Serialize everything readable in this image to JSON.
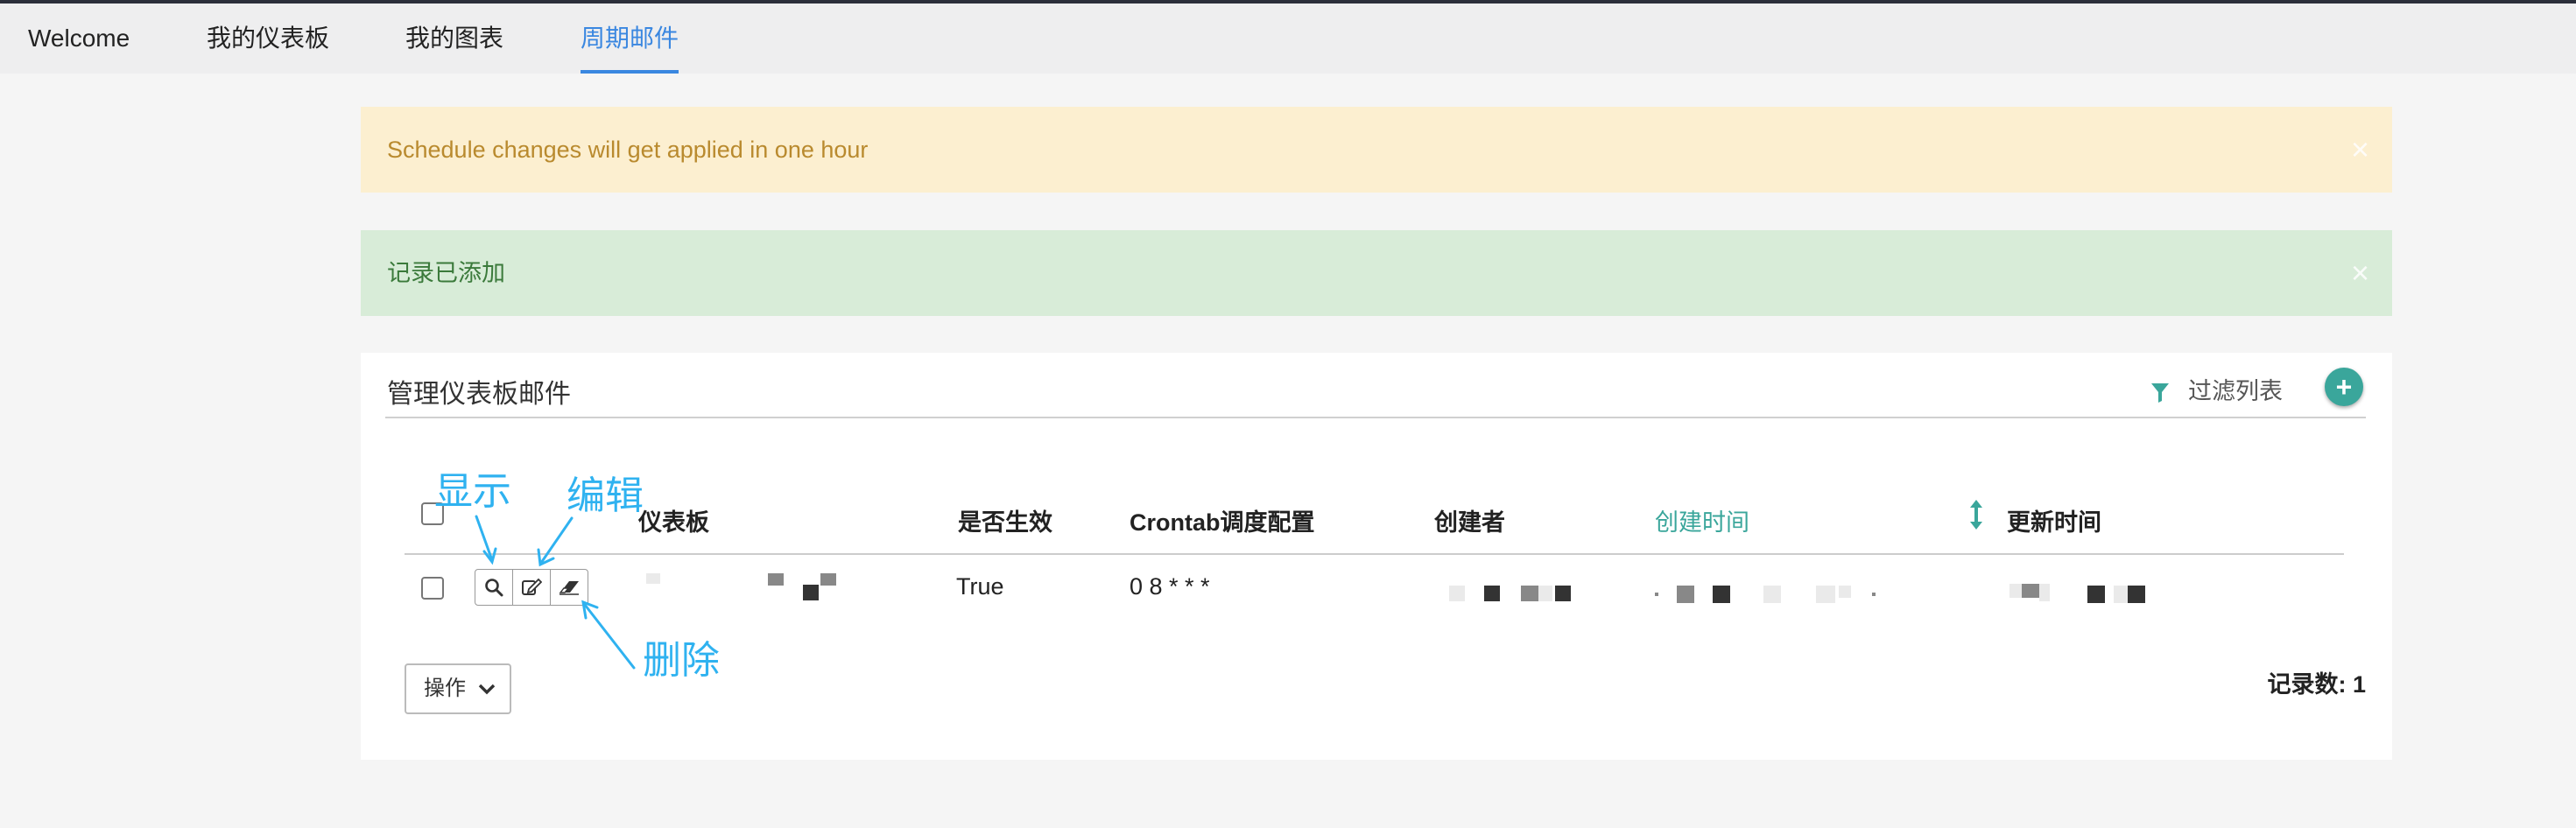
{
  "tabs": [
    {
      "label": "Welcome",
      "active": false
    },
    {
      "label": "我的仪表板",
      "active": false
    },
    {
      "label": "我的图表",
      "active": false
    },
    {
      "label": "周期邮件",
      "active": true
    }
  ],
  "alerts": {
    "warning": {
      "text": "Schedule changes will get applied in one hour",
      "close": "×"
    },
    "success": {
      "text": "记录已添加",
      "close": "×"
    }
  },
  "panel": {
    "title": "管理仪表板邮件",
    "filter_label": "过滤列表",
    "add_label": "+",
    "columns": [
      "仪表板",
      "是否生效",
      "Crontab调度配置",
      "创建者",
      "创建时间",
      "更新时间"
    ],
    "rows": [
      {
        "dashboard": "",
        "active": "True",
        "crontab": "0 8 * * *",
        "creator": "",
        "created": "",
        "updated": ""
      }
    ],
    "actions_label": "操作",
    "record_count": "记录数: 1"
  },
  "annotations": {
    "show": "显示",
    "edit": "编辑",
    "delete": "删除"
  },
  "colors": {
    "accent": "#3a87e0",
    "teal": "#3aa69b",
    "annotation": "#2fb2f0",
    "warning_bg": "#fcefd0",
    "success_bg": "#d8ecd8"
  },
  "icons": [
    "filter-icon",
    "plus-icon",
    "search-icon",
    "edit-icon",
    "eraser-icon",
    "sort-icon",
    "chevron-down-icon",
    "close-icon"
  ]
}
